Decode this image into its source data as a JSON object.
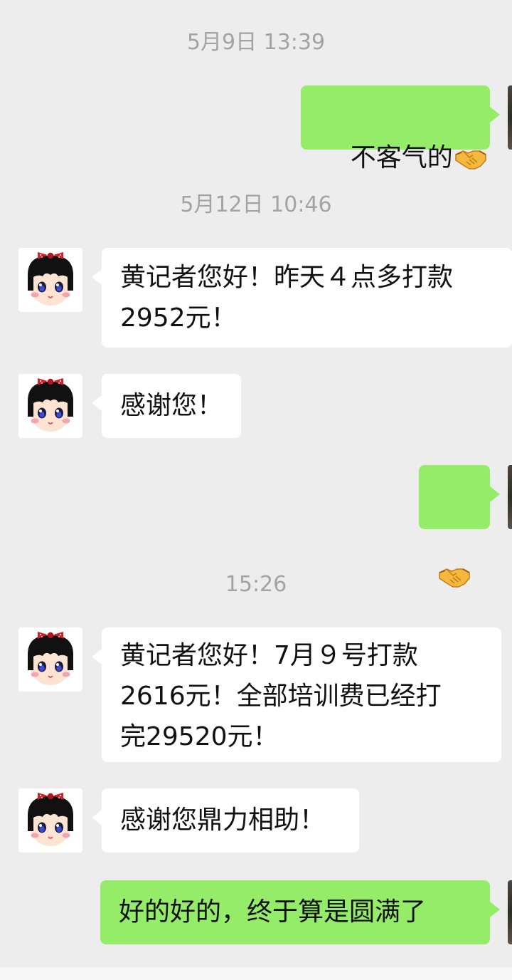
{
  "chat": {
    "timestamps": [
      "5月9日 13:39",
      "5月12日 10:46",
      "15:26"
    ],
    "messages": [
      {
        "from": "self",
        "text": "不客气的",
        "emoji": "handshake-emoji"
      },
      {
        "from": "contact",
        "text": "黄记者您好！昨天４点多打款\n2952元！"
      },
      {
        "from": "contact",
        "text": "感谢您！"
      },
      {
        "from": "self",
        "text": "",
        "emoji": "handshake-emoji"
      },
      {
        "from": "contact",
        "text": "黄记者您好！7月９号打款\n2616元！全部培训费已经打\n完29520元！"
      },
      {
        "from": "contact",
        "text": "感谢您鼎力相助！"
      },
      {
        "from": "self",
        "text": "好的好的，终于算是圆满了"
      }
    ]
  },
  "colors": {
    "background": "#ededed",
    "self_bubble": "#95ec69",
    "contact_bubble": "#ffffff",
    "timestamp": "#a3a3a3"
  },
  "icons": [
    "handshake-emoji",
    "contact-avatar",
    "self-avatar"
  ]
}
